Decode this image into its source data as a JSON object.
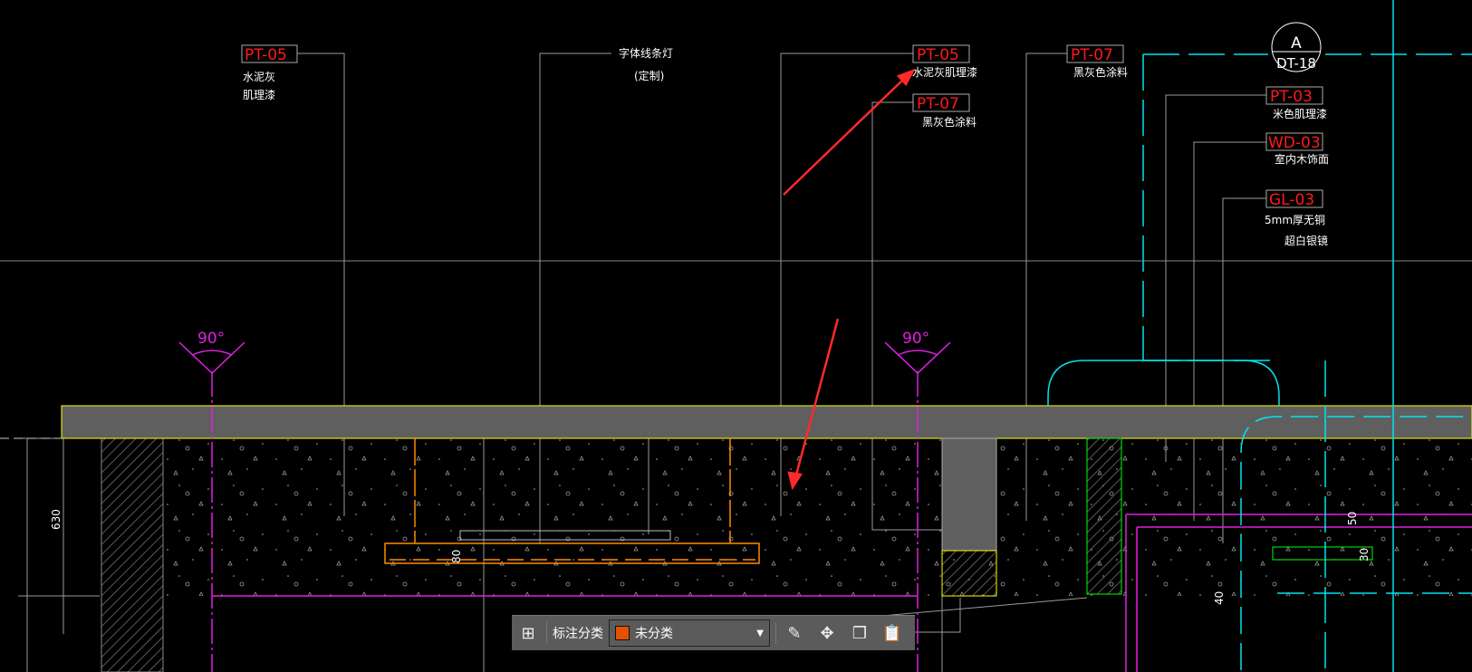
{
  "drawing": {
    "tags": [
      {
        "code": "PT-05",
        "desc": [
          "水泥灰",
          "肌理漆"
        ]
      },
      {
        "code": "PT-05",
        "desc": [
          "水泥灰肌理漆"
        ]
      },
      {
        "code": "PT-07",
        "desc": [
          "黑灰色涂料"
        ]
      },
      {
        "code": "PT-07",
        "desc": [
          "黑灰色涂料"
        ]
      },
      {
        "code": "PT-03",
        "desc": [
          "米色肌理漆"
        ]
      },
      {
        "code": "WD-03",
        "desc": [
          "室内木饰面"
        ]
      },
      {
        "code": "GL-03",
        "desc": [
          "5mm厚无铜",
          "超白银镜"
        ]
      }
    ],
    "light_note": [
      "字体线条灯",
      "(定制)"
    ],
    "section_marker": {
      "letter": "A",
      "sheet": "DT-18"
    },
    "angles": [
      "90°",
      "90°"
    ],
    "dimensions": [
      "630",
      "80",
      "50",
      "30",
      "40"
    ],
    "colors": {
      "slab": "#5f5f5f",
      "outline": "#ffff00",
      "magenta": "#e020e0",
      "cyan": "#00e5ee",
      "orange": "#ff8c00",
      "arrow": "#ff2a2a"
    }
  },
  "toolbar": {
    "category_label": "标注分类",
    "category_value": "未分类",
    "category_color": "#e65100",
    "icons": [
      "grid-icon",
      "edit-icon",
      "move-icon",
      "copy-icon",
      "paste-icon"
    ]
  }
}
